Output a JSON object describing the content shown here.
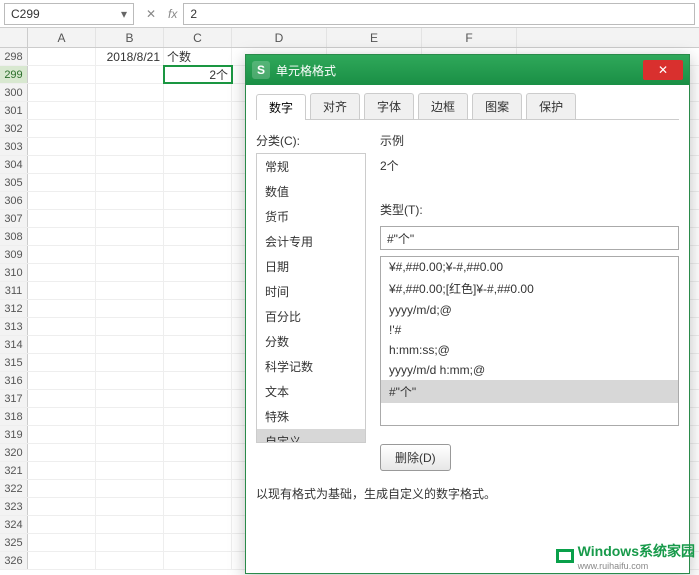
{
  "namebox": {
    "value": "C299"
  },
  "formula_fx": "fx",
  "formula_value": "2",
  "columns": [
    "A",
    "B",
    "C",
    "D",
    "E",
    "F"
  ],
  "row_numbers": [
    298,
    299,
    300,
    301,
    302,
    303,
    304,
    305,
    306,
    307,
    308,
    309,
    310,
    311,
    312,
    313,
    314,
    315,
    316,
    317,
    318,
    319,
    320,
    321,
    322,
    323,
    324,
    325,
    326
  ],
  "cells": {
    "B298": "2018/8/21",
    "C298": "个数",
    "C299": "2个"
  },
  "selected_cell": "C299",
  "selected_row": 299,
  "dialog": {
    "title": "单元格格式",
    "tabs": [
      "数字",
      "对齐",
      "字体",
      "边框",
      "图案",
      "保护"
    ],
    "active_tab": 0,
    "category_label": "分类(C):",
    "categories": [
      "常规",
      "数值",
      "货币",
      "会计专用",
      "日期",
      "时间",
      "百分比",
      "分数",
      "科学记数",
      "文本",
      "特殊",
      "自定义"
    ],
    "active_category": 11,
    "sample_label": "示例",
    "sample_value": "2个",
    "type_label": "类型(T):",
    "type_value": "#\"个\"",
    "formats": [
      "¥#,##0.00;¥-#,##0.00",
      "¥#,##0.00;[红色]¥-#,##0.00",
      "yyyy/m/d;@",
      "!'#",
      "h:mm:ss;@",
      "yyyy/m/d h:mm;@",
      "#\"个\""
    ],
    "active_format": 6,
    "delete_btn": "删除(D)",
    "hint": "以现有格式为基础，生成自定义的数字格式。",
    "close": "✕"
  },
  "watermark": {
    "brand": "indows系统家园",
    "sub": "www.ruihaifu.com",
    "prefix": "W"
  }
}
